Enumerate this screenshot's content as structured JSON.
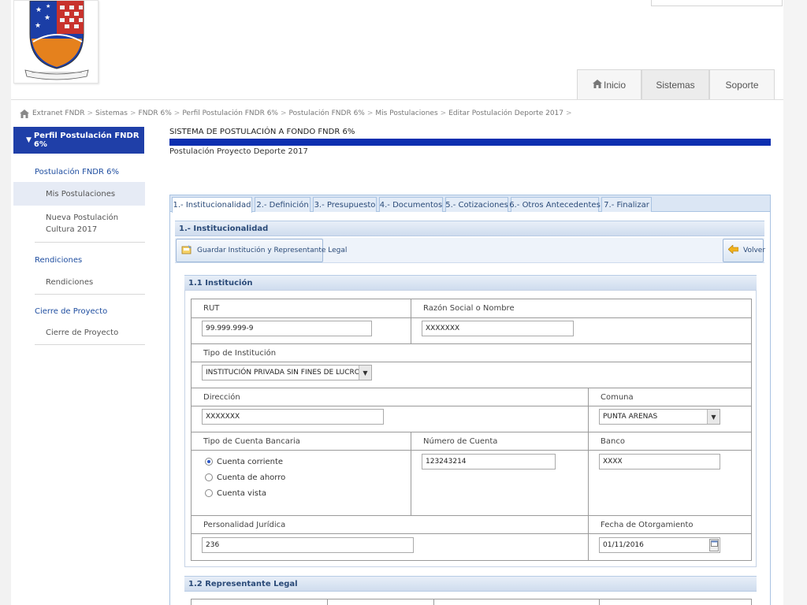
{
  "nav": {
    "tabs": [
      {
        "label": "Inicio",
        "icon": "home-icon"
      },
      {
        "label": "Sistemas"
      },
      {
        "label": "Soporte"
      }
    ]
  },
  "breadcrumb": [
    "Extranet FNDR",
    "Sistemas",
    "FNDR 6%",
    "Perfil Postulación FNDR 6%",
    "Postulación FNDR 6%",
    "Mis Postulaciones",
    "Editar Postulación Deporte 2017"
  ],
  "sidebar": {
    "header": "Perfil Postulación FNDR 6%",
    "groups": [
      {
        "title": "Postulación FNDR 6%",
        "items": [
          "Mis Postulaciones",
          "Nueva Postulación Cultura 2017"
        ]
      },
      {
        "title": "Rendiciones",
        "items": [
          "Rendiciones"
        ]
      },
      {
        "title": "Cierre de Proyecto",
        "items": [
          "Cierre de Proyecto"
        ]
      }
    ]
  },
  "main": {
    "system_title": "SISTEMA DE POSTULACIÓN A FONDO FNDR 6%",
    "subtitle": "Postulación Proyecto Deporte 2017",
    "tabs": [
      "1.- Institucionalidad",
      "2.- Definición",
      "3.- Presupuesto",
      "4.- Documentos",
      "5.- Cotizaciones",
      "6.- Otros Antecedentes",
      "7.- Finalizar"
    ],
    "section_title": "1.- Institucionalidad",
    "save_button": "Guardar Institución y Representante Legal",
    "back_button": "Volver",
    "institution_title": "1.1 Institución",
    "legal_rep_title": "1.2 Representante Legal"
  },
  "form": {
    "rut_label": "RUT",
    "rut_value": "99.999.999-9",
    "razon_label": "Razón Social o Nombre",
    "razon_value": "XXXXXXX",
    "tipo_label": "Tipo de Institución",
    "tipo_value": "INSTITUCIÓN PRIVADA SIN FINES DE LUCRO",
    "direccion_label": "Dirección",
    "direccion_value": "XXXXXXX",
    "comuna_label": "Comuna",
    "comuna_value": "PUNTA ARENAS",
    "cuenta_tipo_label": "Tipo de Cuenta Bancaria",
    "cuenta_options": [
      "Cuenta corriente",
      "Cuenta de ahorro",
      "Cuenta vista"
    ],
    "cuenta_selected": "Cuenta corriente",
    "numero_label": "Número de Cuenta",
    "numero_value": "123243214",
    "banco_label": "Banco",
    "banco_value": "XXXX",
    "personalidad_label": "Personalidad Jurídica",
    "personalidad_value": "236",
    "fecha_label": "Fecha de Otorgamiento",
    "fecha_value": "01/11/2016"
  },
  "colors": {
    "primary": "#1f3fa8",
    "bar": "#0d2fb0",
    "tab_border": "#a9c3e2",
    "link": "#1f4ea0"
  }
}
